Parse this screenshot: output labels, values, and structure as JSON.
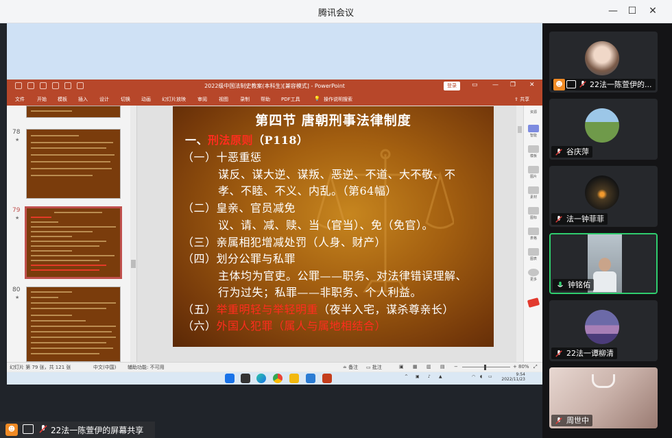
{
  "window": {
    "title": "腾讯会议",
    "minimize": "—",
    "maximize": "☐",
    "close": "✕"
  },
  "ppt": {
    "title": "2022级中国法制史教案(本科生)[兼容模式] - PowerPoint",
    "login": "登录",
    "tabs": [
      "文件",
      "开始",
      "模板",
      "插入",
      "设计",
      "切换",
      "动画",
      "幻灯片放映",
      "审阅",
      "视图",
      "录制",
      "帮助",
      "PDF工具",
      "操作说明搜索"
    ],
    "share": "共享",
    "side_panel_title": "资源",
    "side_labels": [
      "智能",
      "模板",
      "图片",
      "素材",
      "图标",
      "表格",
      "图表",
      "更多"
    ],
    "thumbnails": [
      {
        "num": "78",
        "star": "★"
      },
      {
        "num": "79",
        "star": "★"
      },
      {
        "num": "80",
        "star": "★"
      }
    ],
    "slide": {
      "title": "第四节  唐朝刑事法律制度",
      "lines": [
        {
          "prefix": "一、",
          "red": "刑法原则",
          "suffix": "（P118）"
        },
        {
          "text": "（一）十恶重惩"
        },
        {
          "text": "谋反、谋大逆、谋叛、恶逆、不道、大不敬、不"
        },
        {
          "text": "孝、不睦、不义、内乱。（第64幅）"
        },
        {
          "text": "（二）皇亲、官员减免"
        },
        {
          "text": "议、请、减、赎、当（官当）、免（免官）。"
        },
        {
          "text": "（三）亲属相犯增减处罚（人身、财产）"
        },
        {
          "text": "（四）划分公罪与私罪"
        },
        {
          "text": "主体均为官吏。公罪——职务、对法律错误理解、"
        },
        {
          "text": "行为过失；私罪——非职务、个人利益。"
        },
        {
          "prefix": "（五）",
          "red": "举重明轻与举轻明重",
          "suffix": "（夜半入宅，谋杀尊亲长）"
        },
        {
          "prefix": "（六）",
          "red": "外国人犯罪",
          "mid": "（",
          "red2": "属人与属地相结合",
          "suffix": "）"
        }
      ]
    },
    "status": {
      "slide_info": "幻灯片 第 79 张，共 121 张",
      "language": "中文(中国)",
      "accessibility": "辅助功能: 不可用",
      "notes": "备注",
      "comments": "批注",
      "zoom": "80%"
    },
    "taskbar": {
      "time": "9:54",
      "date": "2022/11/23"
    }
  },
  "share_label": "22法一陈萱伊的屏幕共享",
  "participants": [
    {
      "name": "22法一陈萱伊的..."
    },
    {
      "name": "谷庆萍"
    },
    {
      "name": "法一钟菲菲"
    },
    {
      "name": "钟铭佑"
    },
    {
      "name": "22法一谭柳清"
    },
    {
      "name": "周世中"
    }
  ],
  "colors": {
    "ppt_red": "#b7472a",
    "active_green": "#2fcd6e",
    "slide_red_text": "#ff2d1e",
    "host_orange": "#f08a24"
  }
}
